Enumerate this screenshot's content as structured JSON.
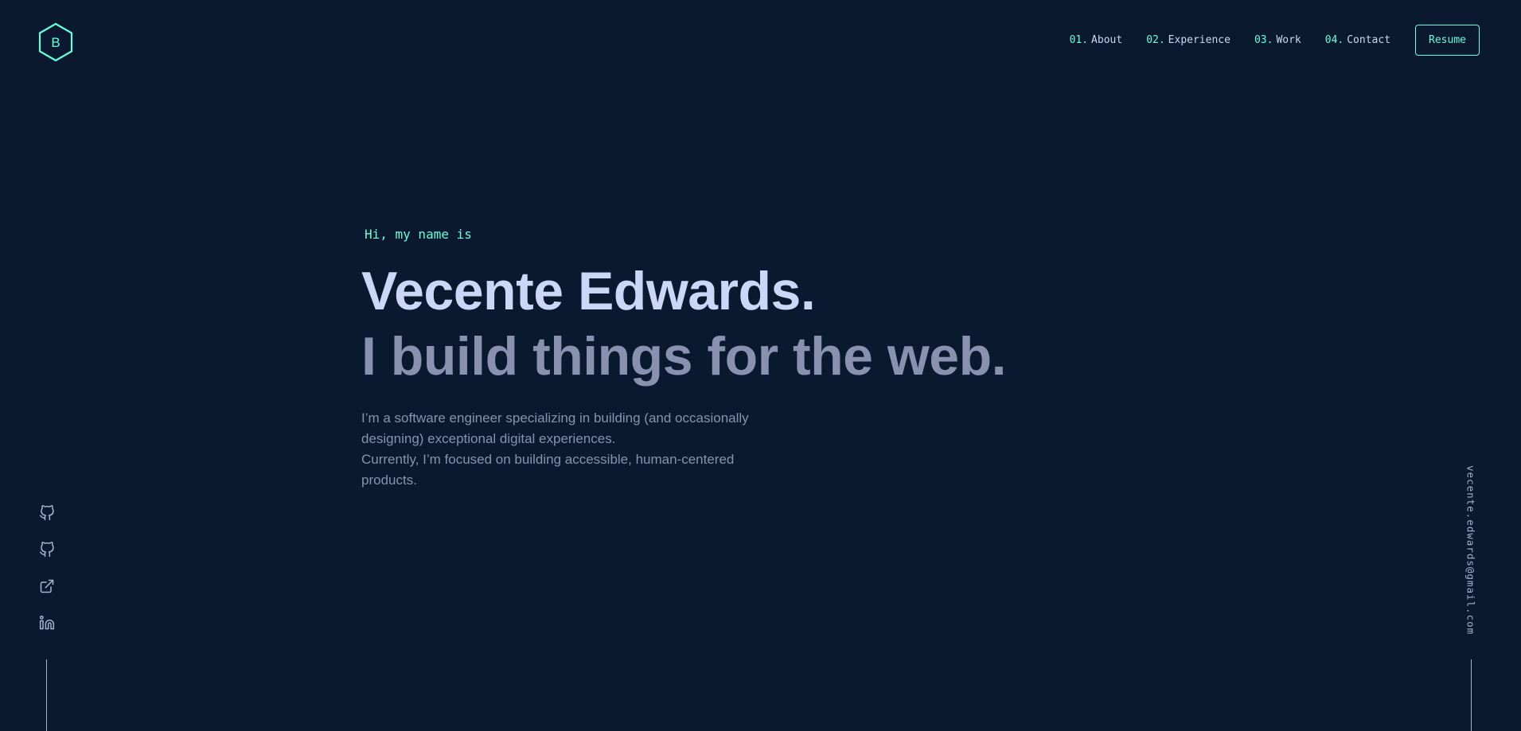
{
  "brand": {
    "logo_letter": "B",
    "accent_color": "#64ffda",
    "background_color": "#0a192f"
  },
  "nav": {
    "items": [
      {
        "number": "01.",
        "label": "About"
      },
      {
        "number": "02.",
        "label": "Experience"
      },
      {
        "number": "03.",
        "label": "Work"
      },
      {
        "number": "04.",
        "label": "Contact"
      }
    ],
    "resume_label": "Resume"
  },
  "hero": {
    "greeting": "Hi, my name is",
    "name": "Vecente Edwards.",
    "tagline": "I build things for the web.",
    "intro_line_1": "I’m a software engineer specializing in building (and occasionally designing) exceptional digital experiences.",
    "intro_line_2": "Currently, I’m focused on building accessible, human-centered products."
  },
  "socials": [
    {
      "icon": "github-icon"
    },
    {
      "icon": "github-icon"
    },
    {
      "icon": "external-link-icon"
    },
    {
      "icon": "linkedin-icon"
    }
  ],
  "email": "vecente.edwards@gmail.com"
}
